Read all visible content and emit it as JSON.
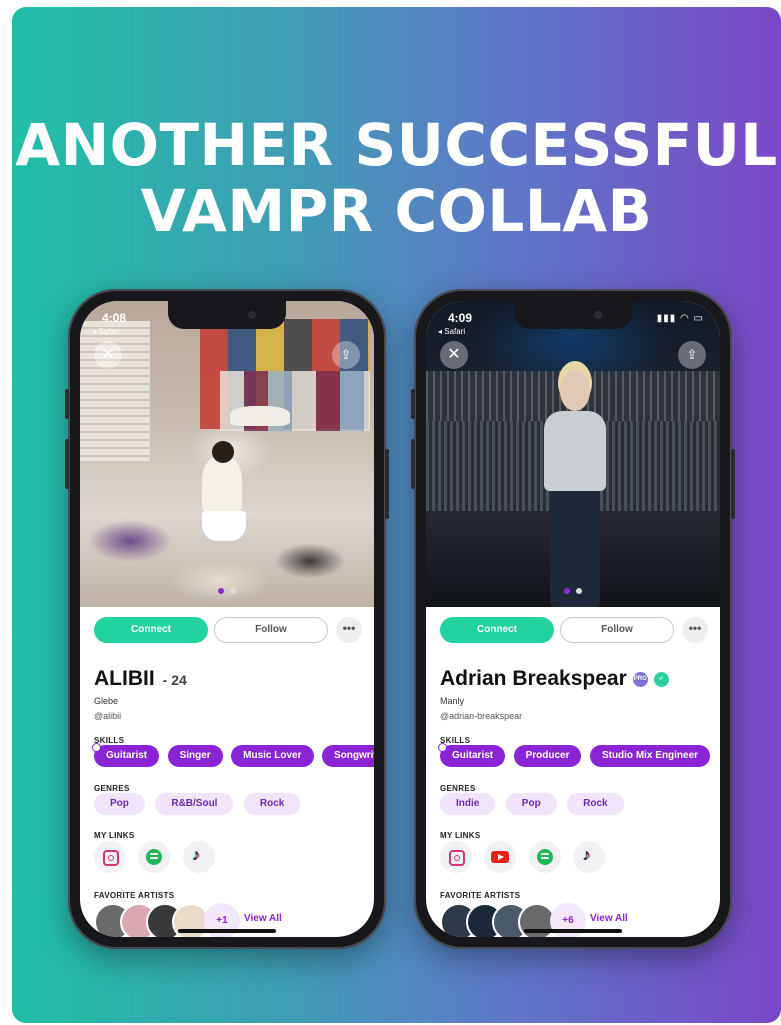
{
  "headline": {
    "line1": "ANOTHER SUCCESSFUL",
    "line2": "VAMPR COLLAB"
  },
  "phones": [
    {
      "status": {
        "time": "4:08",
        "back_app": "◂ Safari",
        "right": ""
      },
      "icons": {
        "close": "close-icon",
        "share": "share-icon"
      },
      "actions": {
        "connect": "Connect",
        "follow": "Follow",
        "more": "•••"
      },
      "profile": {
        "name": "ALIBII",
        "age": "- 24",
        "location": "Glebe",
        "handle": "@alibii"
      },
      "sections": {
        "skills": "SKILLS",
        "genres": "GENRES",
        "links": "MY LINKS",
        "artists": "FAVORITE ARTISTS"
      },
      "skills": [
        "Guitarist",
        "Singer",
        "Music Lover",
        "Songwriter"
      ],
      "genres": [
        "Pop",
        "R&B/Soul",
        "Rock"
      ],
      "links": [
        "instagram-icon",
        "spotify-icon",
        "tiktok-icon"
      ],
      "artists_more": "+1",
      "view_all": "View All",
      "photo_dots": 2
    },
    {
      "status": {
        "time": "4:09",
        "back_app": "◂ Safari",
        "right": ""
      },
      "icons": {
        "close": "close-icon",
        "share": "share-icon"
      },
      "actions": {
        "connect": "Connect",
        "follow": "Follow",
        "more": "•••"
      },
      "profile": {
        "name": "Adrian Breakspear",
        "location": "Manly",
        "handle": "@adrian-breakspear",
        "badge": "PRO"
      },
      "sections": {
        "skills": "SKILLS",
        "genres": "GENRES",
        "links": "MY LINKS",
        "artists": "FAVORITE ARTISTS"
      },
      "skills": [
        "Guitarist",
        "Producer",
        "Studio Mix Engineer"
      ],
      "genres": [
        "Indie",
        "Pop",
        "Rock"
      ],
      "links": [
        "instagram-icon",
        "youtube-icon",
        "spotify-icon",
        "tiktok-icon"
      ],
      "artists_more": "+6",
      "view_all": "View All",
      "photo_dots": 2
    }
  ],
  "colors": {
    "accent_purple": "#8a24d4",
    "connect_green": "#22d3a0",
    "gradient_left": "#1fbfa6",
    "gradient_right": "#7a48c8"
  }
}
